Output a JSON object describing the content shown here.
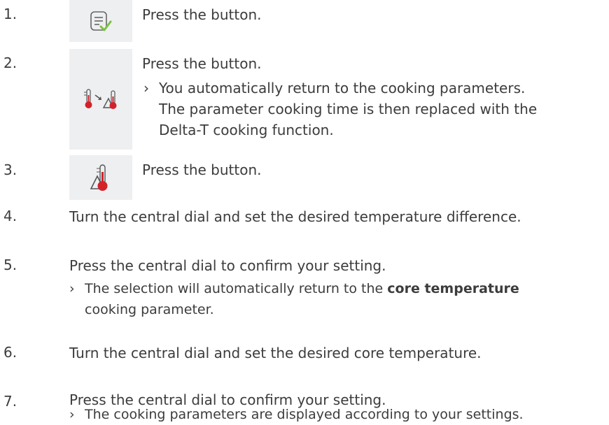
{
  "steps": [
    {
      "num": "1.",
      "text": "Press the button.",
      "icon": "checklist-confirm-icon"
    },
    {
      "num": "2.",
      "text": "Press the button.",
      "icon": "delta-t-switch-icon",
      "result_lines": [
        "You automatically return to the cooking parameters.",
        "The parameter cooking time is then replaced with the",
        "Delta-T cooking function."
      ]
    },
    {
      "num": "3.",
      "text": "Press the button.",
      "icon": "delta-t-thermometer-icon"
    },
    {
      "num": "4.",
      "text": "Turn the central dial and set the desired temperature difference."
    },
    {
      "num": "5.",
      "text": "Press the central dial to confirm your setting.",
      "result_pre": "The selection will automatically return to the ",
      "result_bold": "core temperature",
      "result_line2": "cooking parameter."
    },
    {
      "num": "6.",
      "text": "Turn the central dial and set the desired core temperature."
    },
    {
      "num": "7.",
      "text": "Press the central dial to confirm your setting.",
      "result_lines": [
        "The cooking parameters are displayed according to your settings."
      ]
    }
  ],
  "result_marker": "›",
  "colors": {
    "icon_bg": "#eeeff1",
    "check_green": "#7cc242",
    "thermo_red": "#d2232a",
    "text": "#3c3c3c"
  }
}
